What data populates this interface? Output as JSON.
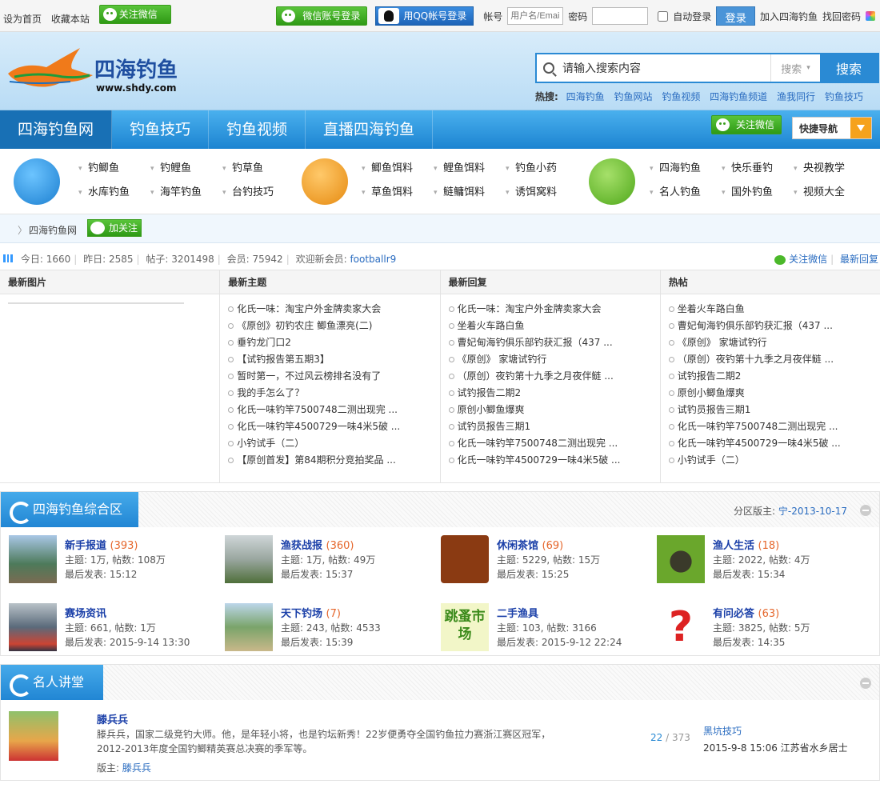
{
  "topbar": {
    "set_home": "设为首页",
    "bookmark": "收藏本站",
    "follow_wechat": "关注微信",
    "wechat_login": "微信账号登录",
    "qq_login": "用QQ帐号登录",
    "account_label": "帐号",
    "account_placeholder": "用户名/Email",
    "password_label": "密码",
    "auto_login": "自动登录",
    "login": "登录",
    "join": "加入四海钓鱼",
    "find_password": "找回密码"
  },
  "header": {
    "logo_text": "四海钓鱼",
    "logo_url": "www.shdy.com",
    "search_placeholder": "请输入搜索内容",
    "search_type": "搜索",
    "search_button": "搜索",
    "hot_label": "热搜:",
    "hot_links": [
      "四海钓鱼",
      "钓鱼网站",
      "钓鱼视频",
      "四海钓鱼频道",
      "渔我同行",
      "钓鱼技巧"
    ]
  },
  "nav": {
    "items": [
      "四海钓鱼网",
      "钓鱼技巧",
      "钓鱼视频",
      "直播四海钓鱼"
    ],
    "follow_wechat": "关注微信",
    "quick_nav": "快捷导航"
  },
  "quick": {
    "g1": [
      "钓鲫鱼",
      "钓鲤鱼",
      "钓草鱼",
      "水库钓鱼",
      "海竿钓鱼",
      "台钓技巧"
    ],
    "g2": [
      "鲫鱼饵料",
      "鲤鱼饵料",
      "钓鱼小药",
      "草鱼饵料",
      "鲢鳙饵料",
      "诱饵窝料"
    ],
    "g3": [
      "四海钓鱼",
      "快乐垂钓",
      "央视教学",
      "名人钓鱼",
      "国外钓鱼",
      "视频大全"
    ]
  },
  "crumb": {
    "home": "四海钓鱼网",
    "follow": "加关注"
  },
  "stats": {
    "today_label": "今日:",
    "today": "1660",
    "yest_label": "昨日:",
    "yest": "2585",
    "posts_label": "帖子:",
    "posts": "3201498",
    "members_label": "会员:",
    "members": "75942",
    "welcome": "欢迎新会员:",
    "new_member": "footballr9",
    "follow": "关注微信",
    "latest_reply": "最新回复"
  },
  "lists": {
    "headers": [
      "最新图片",
      "最新主题",
      "最新回复",
      "热帖"
    ],
    "latest_topics": [
      "化氏一味：淘宝户外金牌卖家大会",
      "《原创》初钓农庄 鲫鱼漂亮(二)",
      "垂钓龙门口2",
      "【试钓报告第五期3】",
      "暂时第一，不过风云榜排名没有了",
      "我的手怎么了？",
      "化氏一味钓竿7500748二测出现完 ...",
      "化氏一味钓竿4500729一味4米5破 ...",
      "小钓试手（二）",
      "【原创首发】第84期积分竞拍奖品 ..."
    ],
    "latest_replies": [
      "化氏一味：淘宝户外金牌卖家大会",
      "坐着火车路白鱼",
      "曹妃甸海钓俱乐部钓获汇报（437 ...",
      "《原创》 家塘试钓行",
      "（原创）夜钓第十九季之月夜伴鲢 ...",
      "试钓报告二期2",
      "原创小鲫鱼爆爽",
      "试钓员报告三期1",
      "化氏一味钓竿7500748二测出现完 ...",
      "化氏一味钓竿4500729一味4米5破 ..."
    ],
    "hot": [
      "坐着火车路白鱼",
      "曹妃甸海钓俱乐部钓获汇报（437 ...",
      "《原创》 家塘试钓行",
      "（原创）夜钓第十九季之月夜伴鲢 ...",
      "试钓报告二期2",
      "原创小鲫鱼爆爽",
      "试钓员报告三期1",
      "化氏一味钓竿7500748二测出现完 ...",
      "化氏一味钓竿4500729一味4米5破 ...",
      "小钓试手（二）"
    ]
  },
  "section1": {
    "title": "四海钓鱼综合区",
    "moderator_label": "分区版主:",
    "moderator": "宁-2013-10-17",
    "forums": [
      {
        "name": "新手报道",
        "count": "(393)",
        "stats": "主题: 1万, 帖数: 108万",
        "last": "最后发表: 15:12"
      },
      {
        "name": "渔获战报",
        "count": "(360)",
        "stats": "主题: 1万, 帖数: 49万",
        "last": "最后发表: 15:37"
      },
      {
        "name": "休闲茶馆",
        "count": "(69)",
        "stats": "主题: 5229, 帖数: 15万",
        "last": "最后发表: 15:25"
      },
      {
        "name": "渔人生活",
        "count": "(18)",
        "stats": "主题: 2022, 帖数: 4万",
        "last": "最后发表: 15:34"
      },
      {
        "name": "赛场资讯",
        "count": "",
        "stats": "主题: 661, 帖数: 1万",
        "last": "最后发表: 2015-9-14 13:30"
      },
      {
        "name": "天下钓场",
        "count": "(7)",
        "stats": "主题: 243, 帖数: 4533",
        "last": "最后发表: 15:39"
      },
      {
        "name": "二手渔具",
        "count": "",
        "stats": "主题: 103, 帖数: 3166",
        "last": "最后发表: 2015-9-12 22:24"
      },
      {
        "name": "有问必答",
        "count": "(63)",
        "stats": "主题: 3825, 帖数: 5万",
        "last": "最后发表: 14:35"
      }
    ],
    "flea_sign": "跳蚤市场"
  },
  "section2": {
    "title": "名人讲堂",
    "name": "滕兵兵",
    "desc": "滕兵兵，国家二级竞钓大师。他，是年轻小将，也是钓坛新秀！22岁便勇夺全国钓鱼拉力赛浙江赛区冠军，2012-2013年度全国钓鲫精英赛总决赛的季军等。",
    "mod_label": "版主:",
    "mod": "滕兵兵",
    "count_a": "22",
    "count_b": "373",
    "last_title": "黑坑技巧",
    "last_info": "2015-9-8 15:06 江苏省水乡居士"
  }
}
